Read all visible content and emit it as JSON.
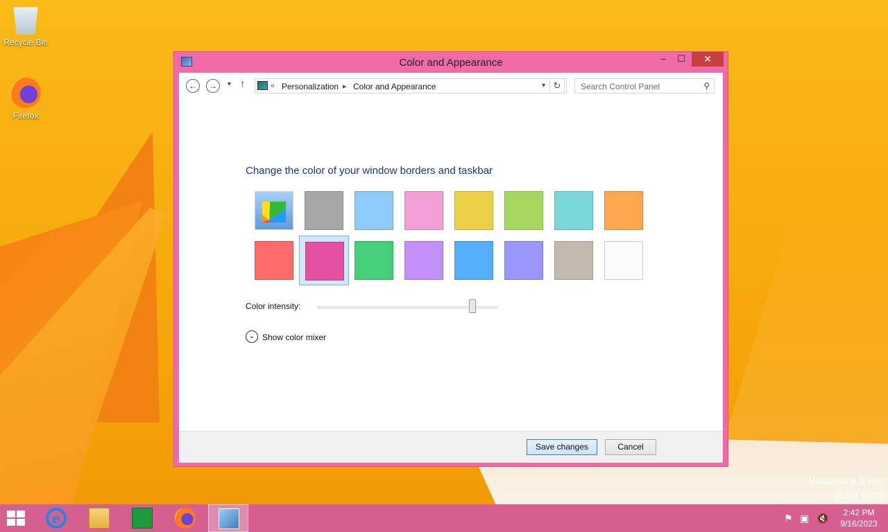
{
  "desktop": {
    "icons": [
      {
        "label": "Recycle Bin",
        "icon": "recycle-bin-icon"
      },
      {
        "label": "Firefox",
        "icon": "firefox-icon"
      }
    ],
    "watermark_line1": "Windows 8.1 Pro",
    "watermark_line2": "Build 9600"
  },
  "window": {
    "title": "Color and Appearance",
    "controls": {
      "minimize": "–",
      "maximize": "☐",
      "close": "✕"
    },
    "breadcrumb": {
      "overflow": "«",
      "items": [
        "Personalization",
        "Color and Appearance"
      ],
      "separator": "▸"
    },
    "search_placeholder": "Search Control Panel",
    "heading": "Change the color of your window borders and taskbar",
    "swatches_row1": [
      {
        "name": "automatic",
        "color": "palette"
      },
      {
        "name": "gray",
        "color": "#a7a7a7"
      },
      {
        "name": "sky-blue",
        "color": "#8ccbfb"
      },
      {
        "name": "light-pink",
        "color": "#f29fd6"
      },
      {
        "name": "yellow",
        "color": "#ecd045"
      },
      {
        "name": "lime",
        "color": "#a8d760"
      },
      {
        "name": "teal",
        "color": "#7ad8d8"
      },
      {
        "name": "orange",
        "color": "#fea74f"
      }
    ],
    "swatches_row2": [
      {
        "name": "red",
        "color": "#fd6a6a"
      },
      {
        "name": "magenta",
        "color": "#e451a3",
        "selected": true
      },
      {
        "name": "green",
        "color": "#43cf78"
      },
      {
        "name": "lavender",
        "color": "#c28ff4"
      },
      {
        "name": "blue",
        "color": "#55aefc"
      },
      {
        "name": "periwinkle",
        "color": "#9a97fc"
      },
      {
        "name": "taupe",
        "color": "#c3b8ad"
      },
      {
        "name": "white",
        "color": "#fbfbfb"
      }
    ],
    "intensity_label": "Color intensity:",
    "intensity_value": 0.86,
    "mixer_label": "Show color mixer",
    "save_label": "Save changes",
    "cancel_label": "Cancel"
  },
  "taskbar": {
    "apps": [
      "start-icon",
      "internet-explorer-icon",
      "file-explorer-icon",
      "store-icon",
      "firefox-icon",
      "control-panel-icon"
    ],
    "time": "2:42 PM",
    "date": "9/16/2023"
  }
}
